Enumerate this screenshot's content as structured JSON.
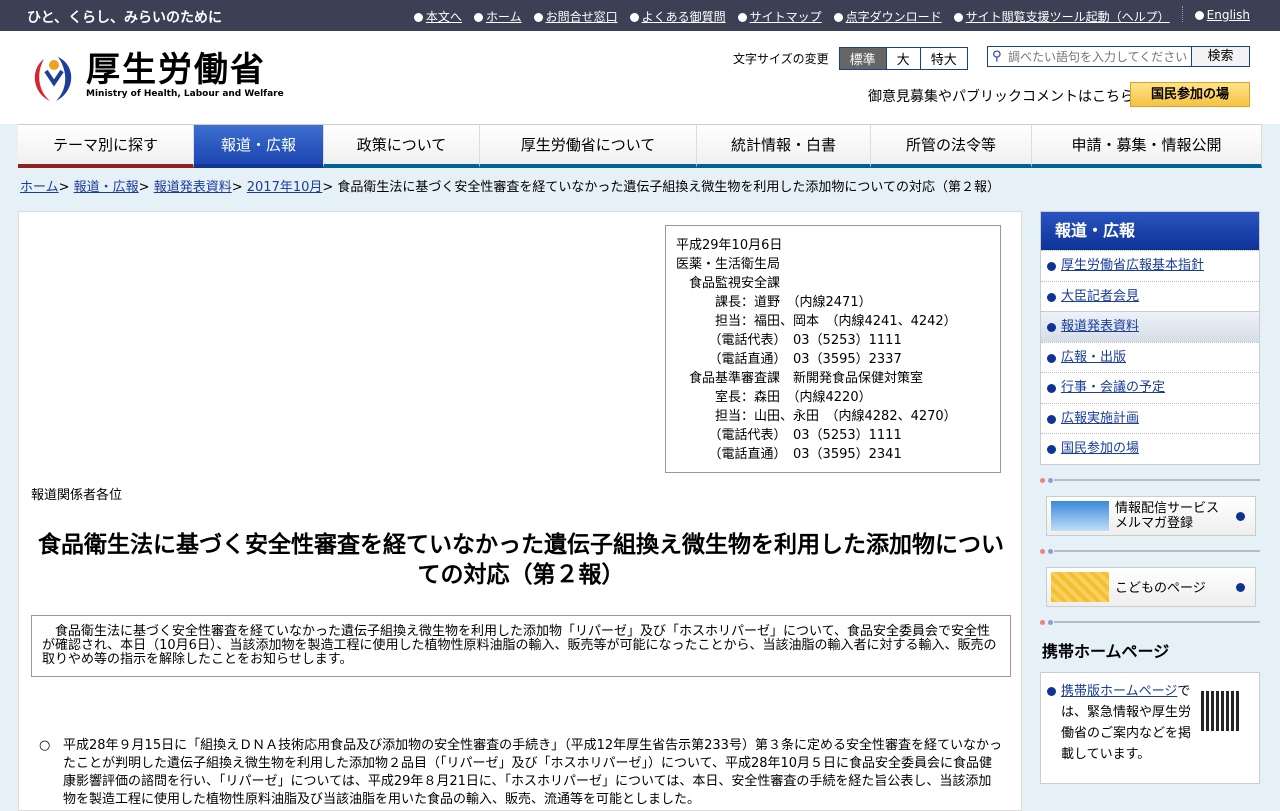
{
  "topbar": {
    "tagline": "ひと、くらし、みらいのために",
    "links": [
      "本文へ",
      "ホーム",
      "お問合せ窓口",
      "よくある御質問",
      "サイトマップ",
      "点字ダウンロード",
      "サイト閲覧支援ツール起動（ヘルプ）"
    ],
    "english": "English"
  },
  "header": {
    "logo_ja": "厚生労働省",
    "logo_en": "Ministry of Health, Labour and Welfare",
    "fontsize_label": "文字サイズの変更",
    "fontsize_options": [
      "標準",
      "大",
      "特大"
    ],
    "search_placeholder": "調べたい語句を入力してください",
    "search_button": "検索",
    "public_comment": "御意見募集やパブリックコメントはこちら",
    "kokumin_button": "国民参加の場"
  },
  "nav": [
    "テーマ別に探す",
    "報道・広報",
    "政策について",
    "厚生労働省について",
    "統計情報・白書",
    "所管の法令等",
    "申請・募集・情報公開"
  ],
  "breadcrumb": {
    "links": [
      "ホーム",
      "報道・広報",
      "報道発表資料",
      "2017年10月"
    ],
    "current": "食品衛生法に基づく安全性審査を経ていなかった遺伝子組換え微生物を利用した添加物についての対応（第２報）"
  },
  "contact": "平成29年10月6日\n医薬・生活衛生局\n　食品監視安全課\n　　　課長：道野　（内線2471）\n　　　担当：福田、岡本　（内線4241、4242）\n　　　（電話代表）　03（5253）1111\n　　　（電話直通）　03（3595）2337\n　食品基準審査課　新開発食品保健対策室\n　　　室長：森田　（内線4220）\n　　　担当：山田、永田　（内線4282、4270）\n　　　（電話代表）　03（5253）1111\n　　　（電話直通）　03（3595）2341",
  "addressee": "報道関係者各位",
  "title": "食品衛生法に基づく安全性審査を経ていなかった遺伝子組換え微生物を利用した添加物についての対応（第２報）",
  "summary": "食品衛生法に基づく安全性審査を経ていなかった遺伝子組換え微生物を利用した添加物「リパーゼ」及び「ホスホリパーゼ」について、食品安全委員会で安全性が確認され、本日（10月6日）、当該添加物を製造工程に使用した植物性原料油脂の輸入、販売等が可能になったことから、当該油脂の輸入者に対する輸入、販売の取りやめ等の指示を解除したことをお知らせします。",
  "bullet_mark": "○",
  "bullet": "平成28年９月15日に「組換えＤＮＡ技術応用食品及び添加物の安全性審査の手続き」（平成12年厚生省告示第233号）第３条に定める安全性審査を経ていなかったことが判明した遺伝子組換え微生物を利用した添加物２品目（「リパーゼ」及び「ホスホリパーゼ」）について、平成28年10月５日に食品安全委員会に食品健康影響評価の諮問を行い、「リパーゼ」については、平成29年８月21日に、「ホスホリパーゼ」については、本日、安全性審査の手続を経た旨公表し、当該添加物を製造工程に使用した植物性原料油脂及び当該油脂を用いた食品の輸入、販売、流通等を可能としました。",
  "sidebar": {
    "heading": "報道・広報",
    "items": [
      "厚生労働省広報基本指針",
      "大臣記者会見",
      "報道発表資料",
      "広報・出版",
      "行事・会議の予定",
      "広報実施計画",
      "国民参加の場"
    ],
    "mail_banner": [
      "情報配信サービス",
      "メルマガ登録"
    ],
    "kids_banner": "こどものページ",
    "mobile_heading": "携帯ホームページ",
    "mobile_link": "携帯版ホームページ",
    "mobile_text": "では、緊急情報や厚生労働省のご案内などを掲載しています。"
  }
}
